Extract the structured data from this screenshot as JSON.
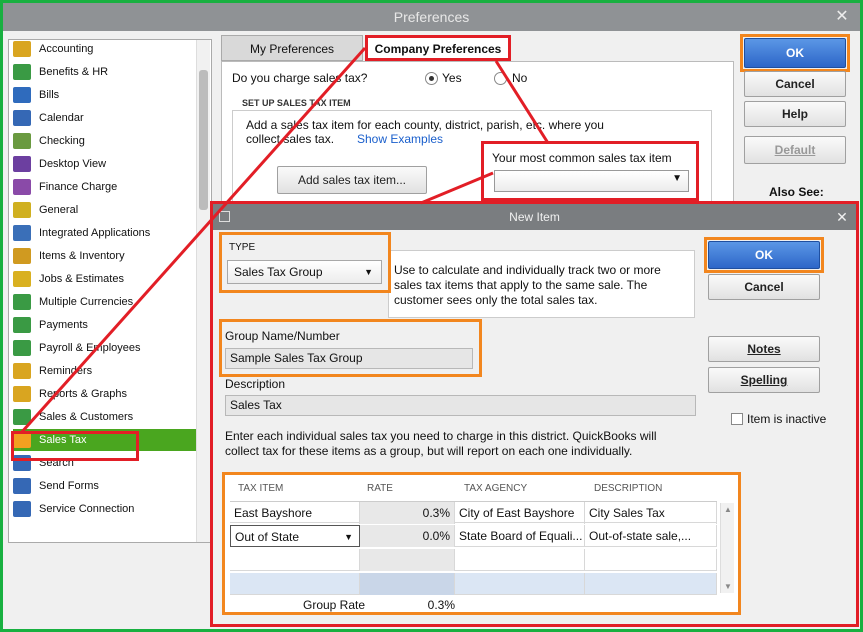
{
  "window": {
    "title": "Preferences",
    "close_glyph": "✕"
  },
  "sidebar": {
    "items": [
      {
        "label": "Accounting",
        "icon": "accounting-icon",
        "color": "#d9a520"
      },
      {
        "label": "Benefits & HR",
        "icon": "benefits-icon",
        "color": "#3a9a44"
      },
      {
        "label": "Bills",
        "icon": "bills-icon",
        "color": "#2f6bbd"
      },
      {
        "label": "Calendar",
        "icon": "calendar-icon",
        "color": "#3568b5"
      },
      {
        "label": "Checking",
        "icon": "checking-icon",
        "color": "#6a9a40"
      },
      {
        "label": "Desktop View",
        "icon": "desktop-view-icon",
        "color": "#6c3fa0"
      },
      {
        "label": "Finance Charge",
        "icon": "finance-charge-icon",
        "color": "#8a4aa8"
      },
      {
        "label": "General",
        "icon": "general-icon",
        "color": "#d0b020"
      },
      {
        "label": "Integrated Applications",
        "icon": "integrated-apps-icon",
        "color": "#3a6fb8"
      },
      {
        "label": "Items & Inventory",
        "icon": "items-inventory-icon",
        "color": "#d09a20"
      },
      {
        "label": "Jobs & Estimates",
        "icon": "jobs-estimates-icon",
        "color": "#d9b020"
      },
      {
        "label": "Multiple Currencies",
        "icon": "multiple-currencies-icon",
        "color": "#3a9a44"
      },
      {
        "label": "Payments",
        "icon": "payments-icon",
        "color": "#3a9a44"
      },
      {
        "label": "Payroll & Employees",
        "icon": "payroll-icon",
        "color": "#3a9a44"
      },
      {
        "label": "Reminders",
        "icon": "reminders-icon",
        "color": "#d9a520"
      },
      {
        "label": "Reports & Graphs",
        "icon": "reports-graphs-icon",
        "color": "#d9a520"
      },
      {
        "label": "Sales & Customers",
        "icon": "sales-customers-icon",
        "color": "#3a9a44"
      },
      {
        "label": "Sales Tax",
        "icon": "sales-tax-icon",
        "color": "#f2a020"
      },
      {
        "label": "Search",
        "icon": "search-icon",
        "color": "#3568b5"
      },
      {
        "label": "Send Forms",
        "icon": "send-forms-icon",
        "color": "#3568b5"
      },
      {
        "label": "Service Connection",
        "icon": "service-connection-icon",
        "color": "#3568b5"
      }
    ],
    "selected_index": 17
  },
  "tabs": {
    "my": "My Preferences",
    "company": "Company Preferences"
  },
  "prefs": {
    "question": "Do you charge sales tax?",
    "yes": "Yes",
    "no": "No",
    "section_header": "SET UP SALES TAX ITEM",
    "setup_text_1": "Add a sales tax item for each county, district, parish, etc. where you",
    "setup_text_2": "collect sales tax.",
    "show_examples": "Show Examples",
    "add_button": "Add sales tax item...",
    "common_item_label": "Your most common sales tax item",
    "common_item_value": ""
  },
  "right_buttons": {
    "ok": "OK",
    "cancel": "Cancel",
    "help": "Help",
    "default": "Default",
    "also_see": "Also See:"
  },
  "new_item": {
    "title": "New Item",
    "type_label": "TYPE",
    "type_value": "Sales Tax Group",
    "type_description": [
      "Use to calculate and individually track two or more",
      "sales tax items that apply to the same sale. The",
      "customer sees only the total sales tax."
    ],
    "ok": "OK",
    "cancel": "Cancel",
    "notes": "Notes",
    "spelling": "Spelling",
    "inactive_label": "Item is inactive",
    "group_label": "Group Name/Number",
    "group_value": "Sample Sales Tax Group",
    "description_label": "Description",
    "description_value": "Sales Tax",
    "instructions_1": "Enter each individual sales tax you need to charge in this district.  QuickBooks will",
    "instructions_2": "collect tax for these items as a group, but will report on each one individually.",
    "grid": {
      "headers": [
        "TAX ITEM",
        "RATE",
        "TAX AGENCY",
        "DESCRIPTION"
      ],
      "rows": [
        {
          "item": "East Bayshore",
          "rate": "0.3%",
          "agency": "City of East Bayshore",
          "description": "City Sales Tax"
        },
        {
          "item": "Out of State",
          "rate": "0.0%",
          "agency": "State Board of Equali...",
          "description": "Out-of-state sale,..."
        }
      ],
      "group_rate_label": "Group Rate",
      "group_rate_value": "0.3%"
    }
  },
  "colors": {
    "annotation_red": "#e21e26",
    "annotation_orange": "#f2861e",
    "accent_green": "#4aa61f"
  }
}
